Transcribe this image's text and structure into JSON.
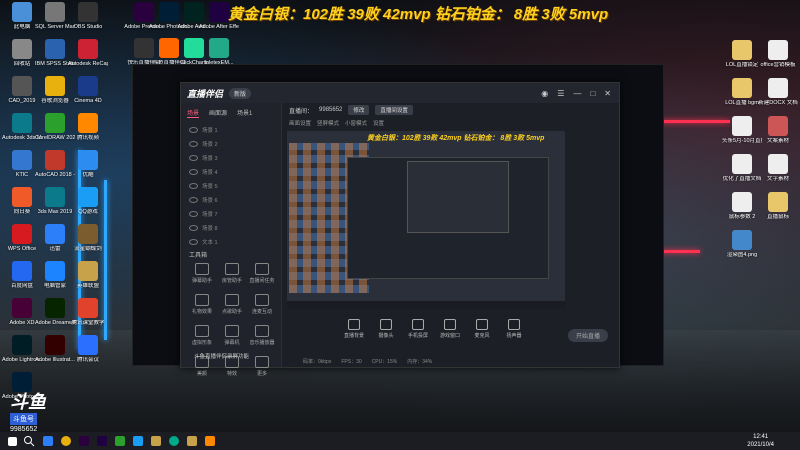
{
  "banner": {
    "text": "黄金白银：102胜 39败 42mvp 钻石铂金： 8胜 3败 5mvp",
    "color": "#ffd21e"
  },
  "desktop_icons_left": [
    {
      "label": "此电脑",
      "icon": "computer-icon",
      "color": "#4a90d9"
    },
    {
      "label": "SQL Server Manage...",
      "icon": "tool-icon",
      "color": "#777"
    },
    {
      "label": "OBS Studio",
      "icon": "obs-icon",
      "color": "#333"
    },
    {
      "label": "回收站",
      "icon": "recycle-bin-icon",
      "color": "#888"
    },
    {
      "label": "IBM SPSS Statistics 21",
      "icon": "spss-icon",
      "color": "#2a62b0"
    },
    {
      "label": "Autodesk ReCap",
      "icon": "recap-icon",
      "color": "#c23"
    },
    {
      "label": "CAD_2019",
      "icon": "cad-icon",
      "color": "#555"
    },
    {
      "label": "谷歌浏览器",
      "icon": "chrome-icon",
      "color": "#e8b10d"
    },
    {
      "label": "Cinema 4D",
      "icon": "c4d-icon",
      "color": "#1a3a8a"
    },
    {
      "label": "Autodesk 3ds Max 2020...",
      "icon": "3dsmax-icon",
      "color": "#0b7a8a"
    },
    {
      "label": "CorelDRAW 2020 (64...",
      "icon": "corel-icon",
      "color": "#2ca02c"
    },
    {
      "label": "腾讯视频",
      "icon": "tencent-video-icon",
      "color": "#f80"
    },
    {
      "label": "KTlC",
      "icon": "app-icon",
      "color": "#3477d0"
    },
    {
      "label": "AutoCAD 2018 - 简...",
      "icon": "autocad-icon",
      "color": "#c0392b"
    },
    {
      "label": "优酷",
      "icon": "youku-icon",
      "color": "#2d8cf0"
    },
    {
      "label": "向日葵",
      "icon": "sunflower-icon",
      "color": "#f05a28"
    },
    {
      "label": "3ds Max 2019",
      "icon": "3dsmax-icon",
      "color": "#0b7a8a"
    },
    {
      "label": "QQ游戏",
      "icon": "qq-game-icon",
      "color": "#1a9ef5"
    },
    {
      "label": "WPS Office",
      "icon": "wps-icon",
      "color": "#d71920"
    },
    {
      "label": "迅雷",
      "icon": "xunlei-icon",
      "color": "#2d7ff9"
    },
    {
      "label": "流星蝴蝶剑",
      "icon": "game-icon",
      "color": "#7a5c2e"
    },
    {
      "label": "百度网盘",
      "icon": "baidu-pan-icon",
      "color": "#2468f2"
    },
    {
      "label": "电脑管家",
      "icon": "pc-manager-icon",
      "color": "#1c84ff"
    },
    {
      "label": "英雄联盟",
      "icon": "lol-icon",
      "color": "#c8a24a"
    },
    {
      "label": "Adobe XD",
      "icon": "xd-icon",
      "color": "#470137"
    },
    {
      "label": "Adobe Dreamwe...",
      "icon": "dw-icon",
      "color": "#072401"
    },
    {
      "label": "腾讯课堂教学",
      "icon": "tencent-class-icon",
      "color": "#e0422c"
    },
    {
      "label": "Adobe Lightroo...",
      "icon": "lr-icon",
      "color": "#001d26"
    },
    {
      "label": "Adobe Illustrat...",
      "icon": "ai-icon",
      "color": "#330000"
    },
    {
      "label": "腾讯会议",
      "icon": "tencent-meeting-icon",
      "color": "#2b6fff"
    },
    {
      "label": "Adobe Photosh...",
      "icon": "ps-icon",
      "color": "#001e36"
    }
  ],
  "desktop_icons_top": [
    {
      "label": "Adobe Premie...",
      "icon": "pr-icon",
      "color": "#2a003f"
    },
    {
      "label": "Adobe Photosh...",
      "icon": "ps-icon",
      "color": "#001e36"
    },
    {
      "label": "Adobe Audi...",
      "icon": "au-icon",
      "color": "#00231f"
    },
    {
      "label": "Adobe After Effects CC ...",
      "icon": "ae-icon",
      "color": "#1f0040"
    }
  ],
  "desktop_icons_top2": [
    {
      "label": "快乐直播伴侣",
      "icon": "live-icon",
      "color": "#333"
    },
    {
      "label": "斗鱼直播伴侣",
      "icon": "douyu-icon",
      "color": "#f60"
    },
    {
      "label": "ClickCharts",
      "icon": "clickcharts-icon",
      "color": "#2d9"
    },
    {
      "label": "InletexEM...",
      "icon": "inletex-icon",
      "color": "#2a8"
    }
  ],
  "desktop_icons_right": [
    {
      "label": "LOL直播锁定",
      "icon": "file-icon",
      "color": "#e8c66a"
    },
    {
      "label": "office营销模板",
      "icon": "pdf-icon",
      "color": "#eee"
    },
    {
      "label": "LOL直播 bgm",
      "icon": "folder-icon",
      "color": "#e8c66a"
    },
    {
      "label": "新建DOCX 文档",
      "icon": "doc-icon",
      "color": "#eee"
    },
    {
      "label": "头条5月-10月直播数据",
      "icon": "pdf-icon",
      "color": "#eee"
    },
    {
      "label": "文案素材",
      "icon": "image-icon",
      "color": "#c55"
    },
    {
      "label": "优化了直播文档",
      "icon": "pdf-icon",
      "color": "#eee"
    },
    {
      "label": "文字素材",
      "icon": "pdf-icon",
      "color": "#eee"
    },
    {
      "label": "鼠标参数 2",
      "icon": "pdf-icon",
      "color": "#eee"
    },
    {
      "label": "直播鼠标",
      "icon": "folder-icon",
      "color": "#e8c66a"
    },
    {
      "label": "渲染图4.png",
      "icon": "image-icon",
      "color": "#48c"
    }
  ],
  "app": {
    "logo_text": "直播伴侣",
    "version": "新版",
    "window_controls": [
      "◉",
      "☰",
      "—",
      "□",
      "✕"
    ],
    "left_tabs": [
      "场景",
      "画面源",
      "场景1"
    ],
    "scenes": [
      "场景 1",
      "场景 2",
      "场景 3",
      "场景 4",
      "场景 5",
      "场景 6",
      "场景 7",
      "场景 8",
      "文本 1"
    ],
    "tools_title": "工具箱",
    "tools": [
      "弹幕助手",
      "房管助手",
      "直播间任务",
      "礼物效果",
      "点歌助手",
      "连麦互动",
      "虚拟形象",
      "弹幕机",
      "音乐播放器",
      "美颜",
      "特效",
      "更多"
    ],
    "room_label": "直播间：",
    "room_id": "9985652",
    "room_chip": "修改",
    "scene_chip": "直播间设置",
    "sub_bar": [
      "画面设置",
      "竖屏模式",
      "小窗模式",
      "设置"
    ],
    "preview_banner": "黄金白银：102胜 39败 42mvp 钻石铂金： 8胜 3败 5mvp",
    "controls": [
      "直播背景",
      "摄像头",
      "手机投屏",
      "游戏窗口",
      "麦克风",
      "扬声器"
    ],
    "start_button": "开始直播",
    "status": [
      "码率：0kbps",
      "FPS：30",
      "CPU：15%",
      "内存：34%"
    ]
  },
  "bottom_strip_text": "斗鱼直播伴侣录屏功能",
  "watermark": {
    "big": "斗鱼",
    "sub": "斗鱼号",
    "number": "9985652"
  },
  "taskbar": {
    "time": "12:41",
    "date": "2021/10/4"
  }
}
